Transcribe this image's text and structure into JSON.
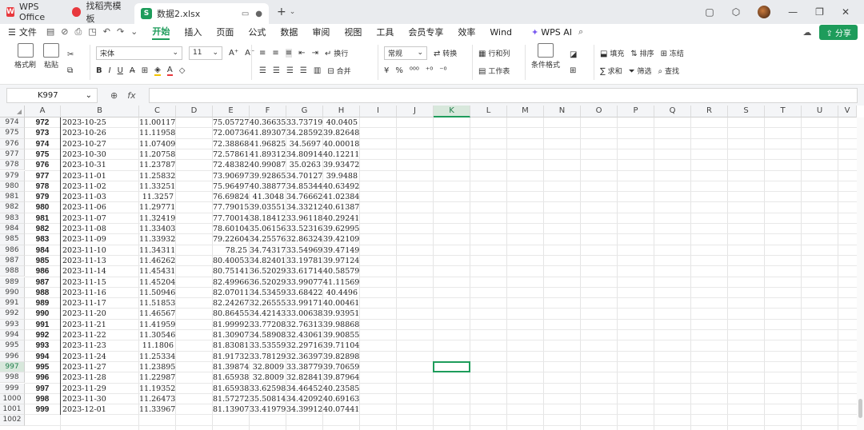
{
  "titlebar": {
    "tabs": [
      {
        "label": "WPS Office"
      },
      {
        "label": "找稻壳模板"
      },
      {
        "label": "数据2.xlsx"
      }
    ],
    "new_tab": "+"
  },
  "menubar": {
    "file": "文件",
    "tabs": [
      "开始",
      "插入",
      "页面",
      "公式",
      "数据",
      "审阅",
      "视图",
      "工具",
      "会员专享",
      "效率",
      "Wind"
    ],
    "active_tab": "开始",
    "wps_ai": "WPS AI",
    "share": "分享"
  },
  "ribbon": {
    "format_painter": "格式刷",
    "paste": "粘贴",
    "font_name": "宋体",
    "font_size": "11",
    "wrap": "换行",
    "merge": "合并",
    "number_format": "常规",
    "convert": "转换",
    "row_col": "行和列",
    "worksheet": "工作表",
    "conditional": "条件格式",
    "fill": "填充",
    "sort": "排序",
    "freeze": "冻结",
    "sum": "求和",
    "filter": "筛选",
    "find": "查找"
  },
  "formula_bar": {
    "name_box": "K997",
    "fx": "fx",
    "value": ""
  },
  "grid": {
    "columns": [
      "A",
      "B",
      "C",
      "D",
      "E",
      "F",
      "G",
      "H",
      "I",
      "J",
      "K",
      "L",
      "M",
      "N",
      "O",
      "P",
      "Q",
      "R",
      "S",
      "T",
      "U",
      "V"
    ],
    "selected_column": "K",
    "selected_row": "997",
    "rows": [
      {
        "r": "974",
        "a": "972",
        "b": "2023-10-25",
        "c": "11.00117",
        "e": "75.05727",
        "f": "40.36635",
        "g": "33.73719",
        "h": "40.0405"
      },
      {
        "r": "975",
        "a": "973",
        "b": "2023-10-26",
        "c": "11.11958",
        "e": "72.00736",
        "f": "41.89307",
        "g": "34.28592",
        "h": "39.82648"
      },
      {
        "r": "976",
        "a": "974",
        "b": "2023-10-27",
        "c": "11.07409",
        "e": "72.38868",
        "f": "41.96825",
        "g": "34.5697",
        "h": "40.00018"
      },
      {
        "r": "977",
        "a": "975",
        "b": "2023-10-30",
        "c": "11.20758",
        "e": "72.57861",
        "f": "41.89312",
        "g": "34.80914",
        "h": "40.12211"
      },
      {
        "r": "978",
        "a": "976",
        "b": "2023-10-31",
        "c": "11.23787",
        "e": "72.48382",
        "f": "40.99087",
        "g": "35.0263",
        "h": "39.93472"
      },
      {
        "r": "979",
        "a": "977",
        "b": "2023-11-01",
        "c": "11.25832",
        "e": "73.90697",
        "f": "39.92865",
        "g": "34.70127",
        "h": "39.9488"
      },
      {
        "r": "980",
        "a": "978",
        "b": "2023-11-02",
        "c": "11.33251",
        "e": "75.96497",
        "f": "40.38877",
        "g": "34.85344",
        "h": "40.63492"
      },
      {
        "r": "981",
        "a": "979",
        "b": "2023-11-03",
        "c": "11.3257",
        "e": "76.69824",
        "f": "41.3048",
        "g": "34.76662",
        "h": "41.02384"
      },
      {
        "r": "982",
        "a": "980",
        "b": "2023-11-06",
        "c": "11.29771",
        "e": "77.79015",
        "f": "39.03551",
        "g": "34.33212",
        "h": "40.61387"
      },
      {
        "r": "983",
        "a": "981",
        "b": "2023-11-07",
        "c": "11.32419",
        "e": "77.70014",
        "f": "38.18412",
        "g": "33.96118",
        "h": "40.29241"
      },
      {
        "r": "984",
        "a": "982",
        "b": "2023-11-08",
        "c": "11.33403",
        "e": "78.60104",
        "f": "35.06156",
        "g": "33.52316",
        "h": "39.62995"
      },
      {
        "r": "985",
        "a": "983",
        "b": "2023-11-09",
        "c": "11.33932",
        "e": "79.22604",
        "f": "34.25576",
        "g": "32.86324",
        "h": "39.42109"
      },
      {
        "r": "986",
        "a": "984",
        "b": "2023-11-10",
        "c": "11.34311",
        "e": "78.25",
        "f": "34.74317",
        "g": "33.54969",
        "h": "39.47149"
      },
      {
        "r": "987",
        "a": "985",
        "b": "2023-11-13",
        "c": "11.46262",
        "e": "80.40053",
        "f": "34.82401",
        "g": "33.19781",
        "h": "39.97124"
      },
      {
        "r": "988",
        "a": "986",
        "b": "2023-11-14",
        "c": "11.45431",
        "e": "80.75141",
        "f": "36.52029",
        "g": "33.61714",
        "h": "40.58579"
      },
      {
        "r": "989",
        "a": "987",
        "b": "2023-11-15",
        "c": "11.45204",
        "e": "82.49966",
        "f": "36.52029",
        "g": "33.99077",
        "h": "41.11569"
      },
      {
        "r": "990",
        "a": "988",
        "b": "2023-11-16",
        "c": "11.50946",
        "e": "82.07011",
        "f": "34.53459",
        "g": "33.68422",
        "h": "40.4496"
      },
      {
        "r": "991",
        "a": "989",
        "b": "2023-11-17",
        "c": "11.51853",
        "e": "82.24267",
        "f": "32.26555",
        "g": "33.99171",
        "h": "40.00461"
      },
      {
        "r": "992",
        "a": "990",
        "b": "2023-11-20",
        "c": "11.46567",
        "e": "80.86455",
        "f": "34.42143",
        "g": "33.00638",
        "h": "39.93951"
      },
      {
        "r": "993",
        "a": "991",
        "b": "2023-11-21",
        "c": "11.41959",
        "e": "81.99992",
        "f": "33.77208",
        "g": "32.76313",
        "h": "39.98868"
      },
      {
        "r": "994",
        "a": "992",
        "b": "2023-11-22",
        "c": "11.30546",
        "e": "81.30907",
        "f": "34.58908",
        "g": "32.43061",
        "h": "39.90855"
      },
      {
        "r": "995",
        "a": "993",
        "b": "2023-11-23",
        "c": "11.1806",
        "e": "81.83081",
        "f": "33.53559",
        "g": "32.29716",
        "h": "39.71104"
      },
      {
        "r": "996",
        "a": "994",
        "b": "2023-11-24",
        "c": "11.25334",
        "e": "81.91732",
        "f": "33.78129",
        "g": "32.36397",
        "h": "39.82898"
      },
      {
        "r": "997",
        "a": "995",
        "b": "2023-11-27",
        "c": "11.23895",
        "e": "81.39874",
        "f": "32.8009",
        "g": "33.38779",
        "h": "39.70659"
      },
      {
        "r": "998",
        "a": "996",
        "b": "2023-11-28",
        "c": "11.22987",
        "e": "81.65938",
        "f": "32.8009",
        "g": "32.82841",
        "h": "39.87964"
      },
      {
        "r": "999",
        "a": "997",
        "b": "2023-11-29",
        "c": "11.19352",
        "e": "81.65938",
        "f": "33.62598",
        "g": "34.46452",
        "h": "40.23585"
      },
      {
        "r": "1000",
        "a": "998",
        "b": "2023-11-30",
        "c": "11.26473",
        "e": "81.57272",
        "f": "35.50814",
        "g": "34.42092",
        "h": "40.69163"
      },
      {
        "r": "1001",
        "a": "999",
        "b": "2023-12-01",
        "c": "11.33967",
        "e": "81.13907",
        "f": "33.41979",
        "g": "34.39912",
        "h": "40.07441"
      },
      {
        "r": "1002",
        "a": "",
        "b": "",
        "c": "",
        "e": "",
        "f": "",
        "g": "",
        "h": ""
      }
    ]
  }
}
